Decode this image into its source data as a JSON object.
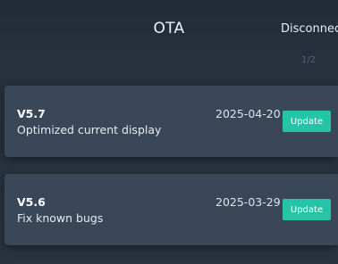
{
  "header": {
    "title": "OTA",
    "disconnect_label": "Disconnect",
    "pager": "1/2"
  },
  "firmware_list": [
    {
      "version": "V5.7",
      "date": "2025-04-20",
      "description": "Optimized current display",
      "action_label": "Update"
    },
    {
      "version": "V5.6",
      "date": "2025-03-29",
      "description": "Fix known bugs",
      "action_label": "Update"
    }
  ],
  "colors": {
    "background": "#2a3441",
    "card": "#3a4758",
    "accent": "#25c4a8"
  }
}
